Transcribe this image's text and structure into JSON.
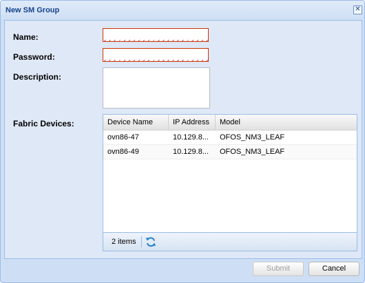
{
  "dialog": {
    "title": "New SM Group",
    "close_glyph": "✕"
  },
  "form": {
    "name_label": "Name:",
    "name_value": "",
    "password_label": "Password:",
    "password_value": "",
    "description_label": "Description:",
    "description_value": "",
    "fabric_label": "Fabric Devices:"
  },
  "grid": {
    "columns": [
      "Device Name",
      "IP Address",
      "Model"
    ],
    "rows": [
      {
        "device_name": "ovn86-47",
        "ip_address": "10.129.8...",
        "model": "OFOS_NM3_LEAF"
      },
      {
        "device_name": "ovn86-49",
        "ip_address": "10.129.8...",
        "model": "OFOS_NM3_LEAF"
      }
    ],
    "item_count": "2 items",
    "refresh_icon": "refresh-icon"
  },
  "buttons": {
    "submit": "Submit",
    "cancel": "Cancel"
  },
  "colors": {
    "title_text": "#15428b",
    "panel_bg": "#dfe8f6",
    "invalid_border": "#cc3300"
  }
}
